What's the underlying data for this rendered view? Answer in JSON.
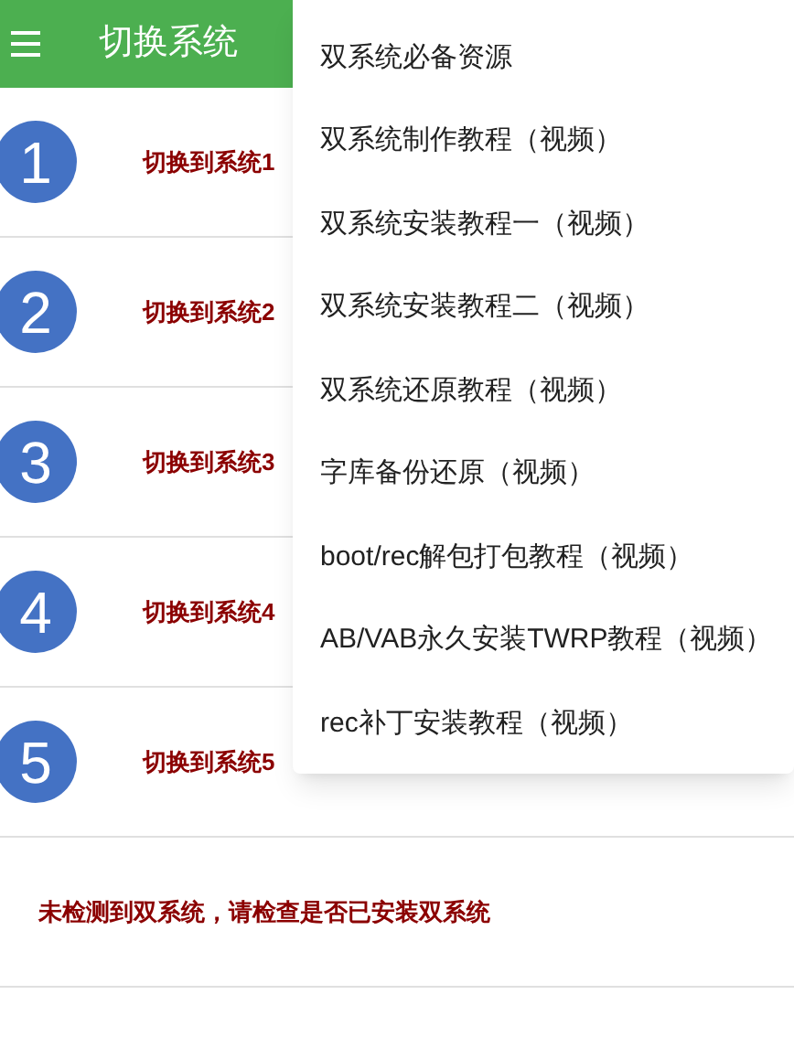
{
  "app_bar": {
    "title": "切换系统"
  },
  "systems": [
    {
      "number": "1",
      "label": "切换到系统1"
    },
    {
      "number": "2",
      "label": "切换到系统2"
    },
    {
      "number": "3",
      "label": "切换到系统3"
    },
    {
      "number": "4",
      "label": "切换到系统4"
    },
    {
      "number": "5",
      "label": "切换到系统5"
    }
  ],
  "status_message": "未检测到双系统，请检查是否已安装双系统",
  "menu": {
    "items": [
      "双系统必备资源",
      "双系统制作教程（视频）",
      "双系统安装教程一（视频）",
      "双系统安装教程二（视频）",
      "双系统还原教程（视频）",
      "字库备份还原（视频）",
      "boot/rec解包打包教程（视频）",
      "AB/VAB永久安装TWRP教程（视频）",
      "rec补丁安装教程（视频）"
    ]
  }
}
